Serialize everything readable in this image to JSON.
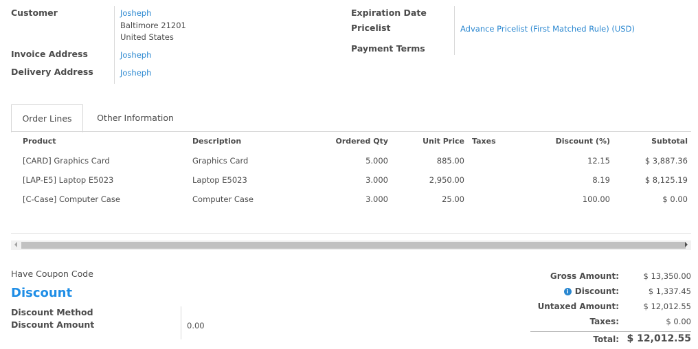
{
  "header": {
    "customer_label": "Customer",
    "customer_name": "Josheph",
    "customer_address_line1": "Baltimore 21201",
    "customer_address_line2": "United States",
    "invoice_address_label": "Invoice Address",
    "invoice_address_value": "Josheph",
    "delivery_address_label": "Delivery Address",
    "delivery_address_value": "Josheph",
    "expiration_date_label": "Expiration Date",
    "pricelist_label": "Pricelist",
    "pricelist_value": "Advance Pricelist (First Matched Rule) (USD)",
    "payment_terms_label": "Payment Terms"
  },
  "tabs": [
    {
      "label": "Order Lines",
      "active": true
    },
    {
      "label": "Other Information",
      "active": false
    }
  ],
  "table": {
    "columns": [
      "Product",
      "Description",
      "Ordered Qty",
      "Unit Price",
      "Taxes",
      "Discount (%)",
      "Subtotal"
    ],
    "rows": [
      {
        "product": "[CARD] Graphics Card",
        "description": "Graphics Card",
        "qty": "5.000",
        "unit_price": "885.00",
        "taxes": "",
        "discount": "12.15",
        "subtotal": "$ 3,887.36"
      },
      {
        "product": "[LAP-E5] Laptop E5023",
        "description": "Laptop E5023",
        "qty": "3.000",
        "unit_price": "2,950.00",
        "taxes": "",
        "discount": "8.19",
        "subtotal": "$ 8,125.19"
      },
      {
        "product": "[C-Case] Computer Case",
        "description": "Computer Case",
        "qty": "3.000",
        "unit_price": "25.00",
        "taxes": "",
        "discount": "100.00",
        "subtotal": "$ 0.00"
      }
    ]
  },
  "coupon": {
    "link_label": "Have Coupon Code"
  },
  "discount": {
    "heading": "Discount",
    "method_label": "Discount Method",
    "amount_label": "Discount Amount",
    "amount_value": "0.00"
  },
  "totals": {
    "gross_label": "Gross Amount:",
    "gross_value": "$ 13,350.00",
    "discount_label": "Discount:",
    "discount_value": "$ 1,337.45",
    "untaxed_label": "Untaxed Amount:",
    "untaxed_value": "$ 12,012.55",
    "taxes_label": "Taxes:",
    "taxes_value": "$ 0.00",
    "total_label": "Total:",
    "total_value": "$ 12,012.55"
  },
  "icons": {
    "discount_info": "info-icon"
  },
  "colors": {
    "link": "#2a87d0",
    "heading": "#1f8ee6",
    "text": "#4c4c4c"
  }
}
